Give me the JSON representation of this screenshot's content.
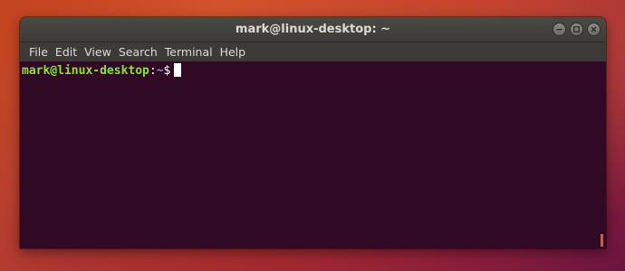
{
  "window": {
    "title": "mark@linux-desktop: ~"
  },
  "menu": [
    {
      "label": "File"
    },
    {
      "label": "Edit"
    },
    {
      "label": "View"
    },
    {
      "label": "Search"
    },
    {
      "label": "Terminal"
    },
    {
      "label": "Help"
    }
  ],
  "terminal": {
    "prompt_user_host": "mark@linux-desktop",
    "prompt_separator": ":",
    "prompt_path": "~",
    "prompt_symbol": "$"
  },
  "colors": {
    "terminal_bg": "#300a24",
    "prompt_user": "#8ae234",
    "prompt_path": "#729fcf",
    "accent": "#e95420"
  },
  "icons": {
    "minimize": "minimize-icon",
    "maximize": "maximize-icon",
    "close": "close-icon"
  }
}
